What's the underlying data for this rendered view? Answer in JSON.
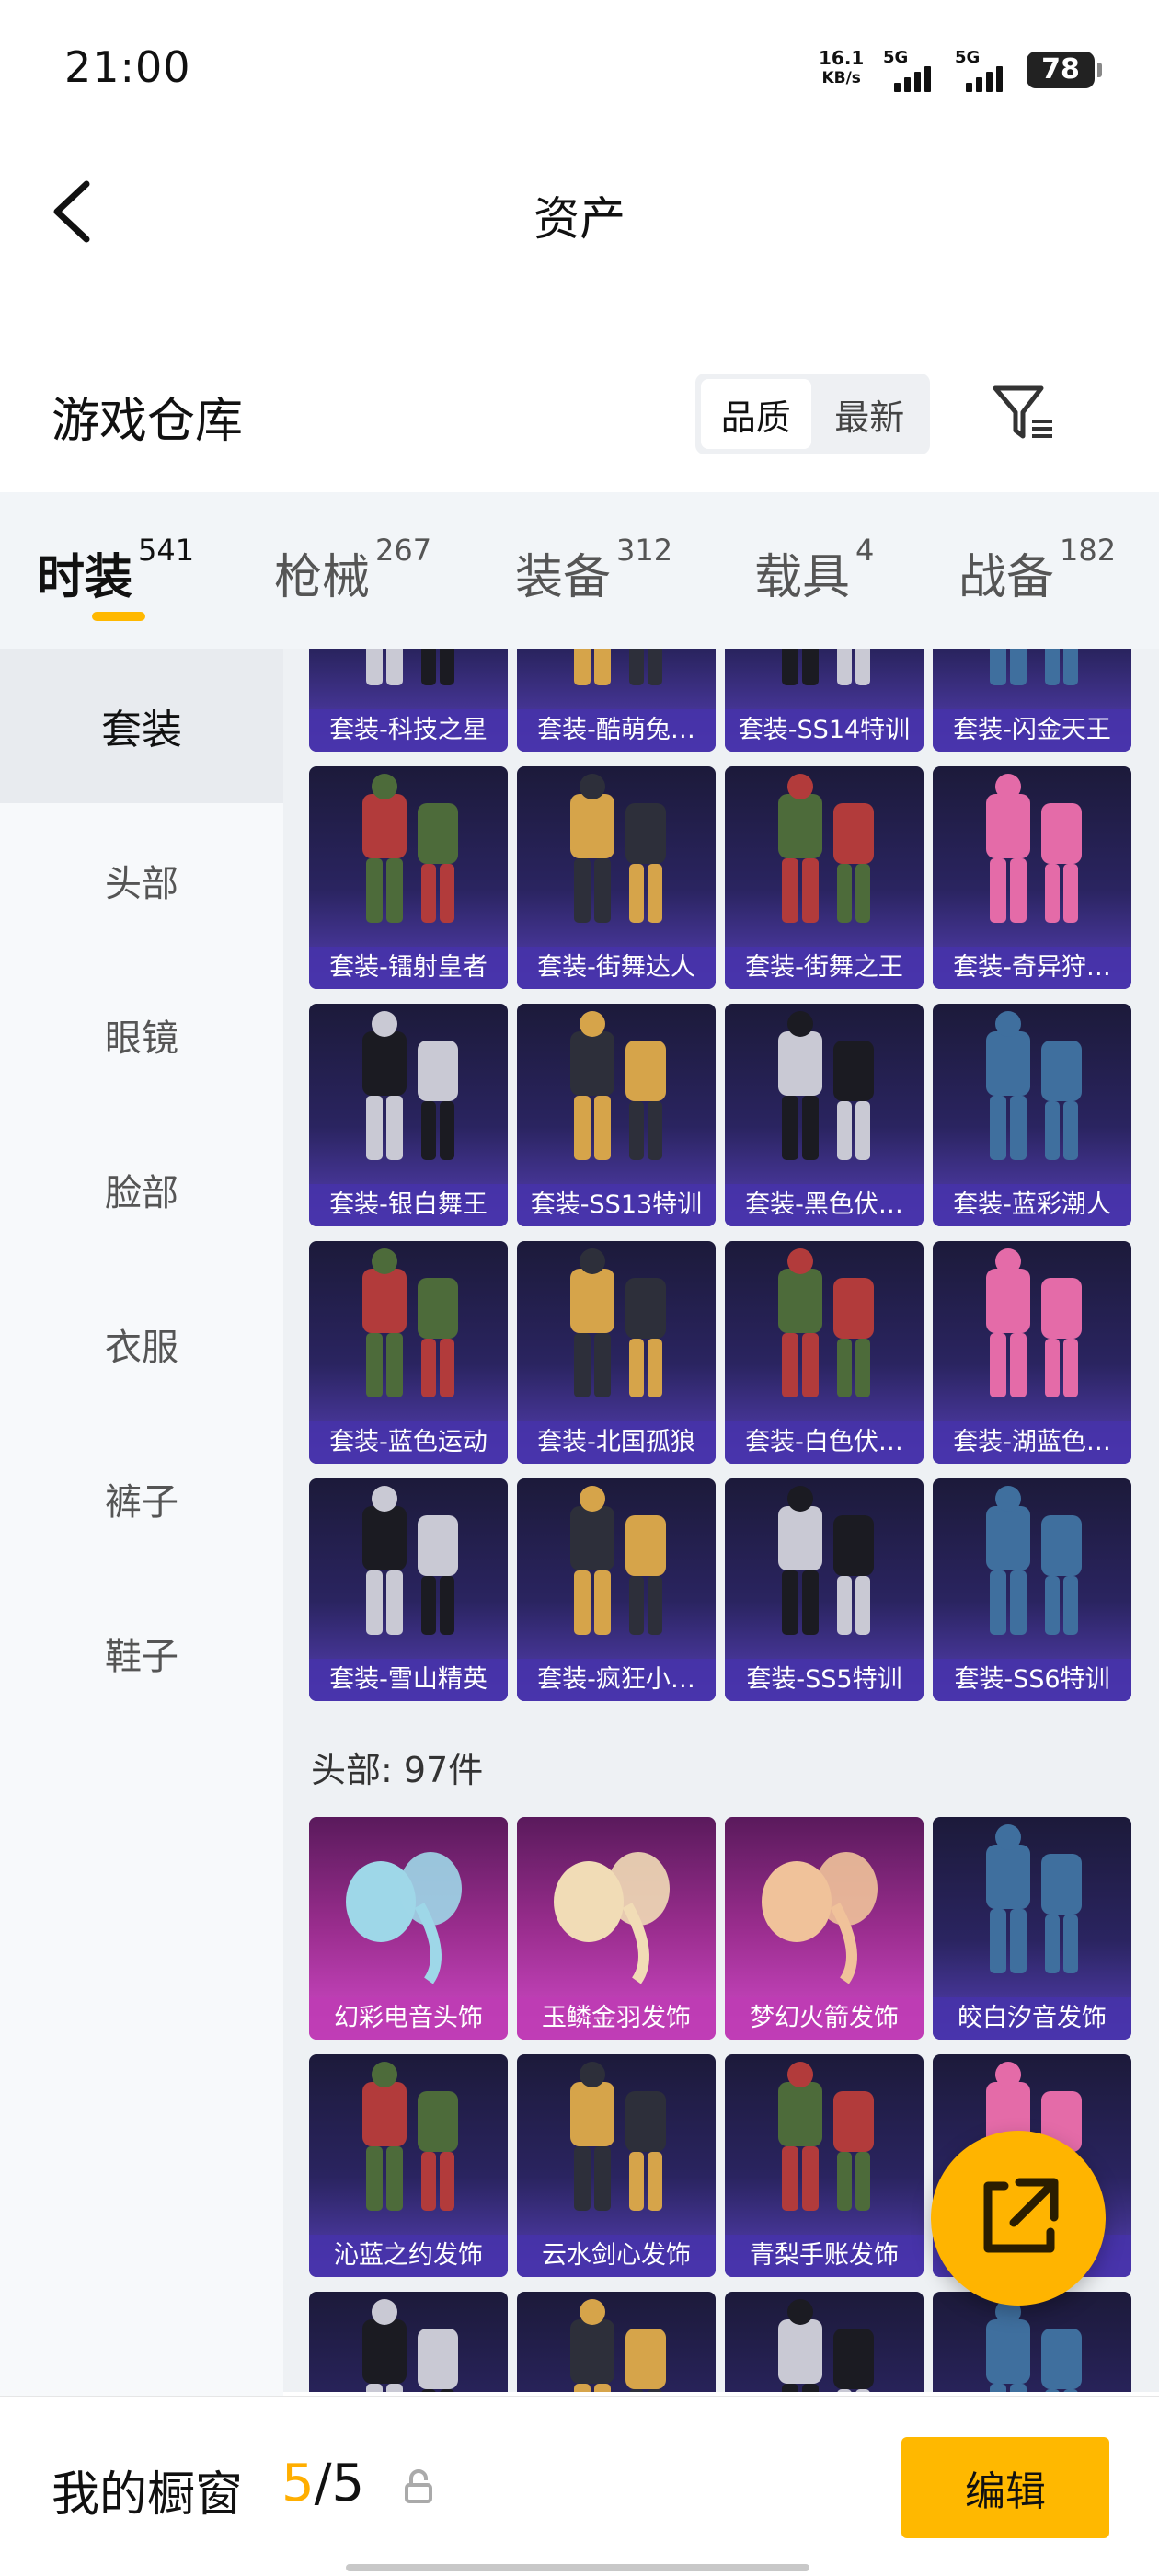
{
  "status": {
    "time": "21:00",
    "net_speed_value": "16.1",
    "net_speed_unit": "KB/s",
    "sim1_label": "5G",
    "sim2_label": "5G",
    "battery": "78"
  },
  "header": {
    "title": "资产"
  },
  "warehouse": {
    "title": "游戏仓库",
    "sort_options": [
      "品质",
      "最新"
    ],
    "sort_selected": "品质"
  },
  "categories": [
    {
      "label": "时装",
      "count": "541"
    },
    {
      "label": "枪械",
      "count": "267"
    },
    {
      "label": "装备",
      "count": "312"
    },
    {
      "label": "载具",
      "count": "4"
    },
    {
      "label": "战备",
      "count": "182"
    }
  ],
  "sidebar": {
    "items": [
      "套装",
      "头部",
      "眼镜",
      "脸部",
      "衣服",
      "裤子",
      "鞋子"
    ]
  },
  "suits": [
    "套装-科技之星",
    "套装-酷萌兔…",
    "套装-SS14特训",
    "套装-闪金天王",
    "套装-镭射皇者",
    "套装-街舞达人",
    "套装-街舞之王",
    "套装-奇异狩…",
    "套装-银白舞王",
    "套装-SS13特训",
    "套装-黑色伏…",
    "套装-蓝彩潮人",
    "套装-蓝色运动",
    "套装-北国孤狼",
    "套装-白色伏…",
    "套装-湖蓝色…",
    "套装-雪山精英",
    "套装-疯狂小…",
    "套装-SS5特训",
    "套装-SS6特训"
  ],
  "head_section": {
    "title": "头部: 97件"
  },
  "heads": [
    "幻彩电音头饰",
    "玉鳞金羽发饰",
    "梦幻火箭发饰",
    "皎白汐音发饰",
    "沁蓝之约发饰",
    "云水剑心发饰",
    "青梨手账发饰",
    "",
    "",
    "",
    "",
    ""
  ],
  "bottom": {
    "window_label": "我的橱窗",
    "window_current": "5",
    "window_total": "/5",
    "edit_label": "编辑"
  },
  "colors": {
    "accent": "#ffb800",
    "card_purple": "#2a2460",
    "card_pink": "#9a2d8e"
  }
}
